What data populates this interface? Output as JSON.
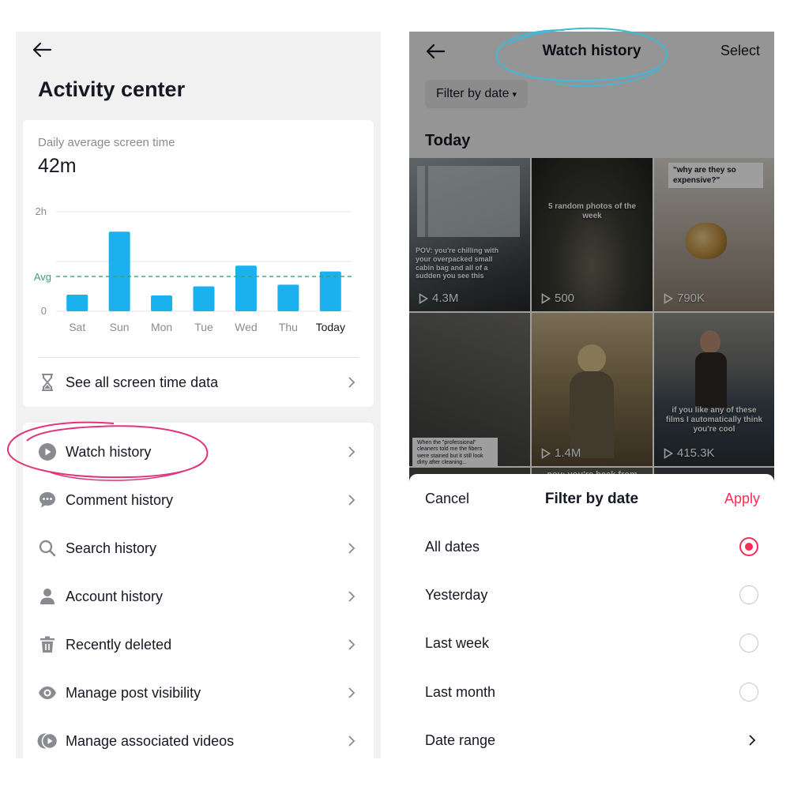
{
  "left": {
    "page_title": "Activity center",
    "chart_card": {
      "caption": "Daily average screen time",
      "value": "42m",
      "see_all_label": "See all screen time data"
    },
    "menu": [
      {
        "label": "Watch history",
        "icon": "play-circle-icon"
      },
      {
        "label": "Comment history",
        "icon": "comment-bubble-icon"
      },
      {
        "label": "Search history",
        "icon": "search-icon"
      },
      {
        "label": "Account history",
        "icon": "person-icon"
      },
      {
        "label": "Recently deleted",
        "icon": "trash-icon"
      },
      {
        "label": "Manage post visibility",
        "icon": "eye-icon"
      },
      {
        "label": "Manage associated videos",
        "icon": "associated-videos-icon"
      }
    ]
  },
  "chart_data": {
    "type": "bar",
    "categories": [
      "Sat",
      "Sun",
      "Mon",
      "Tue",
      "Wed",
      "Thu",
      "Today"
    ],
    "values": [
      20,
      96,
      19,
      30,
      55,
      32,
      48
    ],
    "y_unit": "minutes",
    "ytick_labels": [
      "0",
      "2h"
    ],
    "ylim": [
      0,
      120
    ],
    "avg_label": "Avg",
    "avg_value": 42,
    "bar_color": "#1bb0ee",
    "avg_color": "#3d9b7f",
    "grid": true
  },
  "right": {
    "title": "Watch history",
    "select_label": "Select",
    "filter_chip_label": "Filter by date",
    "section_label": "Today",
    "thumbnails": [
      {
        "views": "4.3M",
        "overlay": "POV: you're chilling with your overpacked small cabin bag and all of a sudden you see this"
      },
      {
        "views": "500",
        "overlay": "5 random photos of the week"
      },
      {
        "views": "790K",
        "overlay": "\"why are they so expensive?\""
      },
      {
        "views": "",
        "overlay": "When the \"professional\" cleaners told me the fibers were stained but it still look dirty after cleaning..."
      },
      {
        "views": "1.4M",
        "overlay": ""
      },
      {
        "views": "415.3K",
        "overlay": "if you like any of these films I automatically think you're cool"
      }
    ],
    "peek_caption": "pov: you're back from",
    "sheet": {
      "cancel_label": "Cancel",
      "title": "Filter by date",
      "apply_label": "Apply",
      "options": [
        {
          "label": "All dates",
          "selected": true
        },
        {
          "label": "Yesterday",
          "selected": false
        },
        {
          "label": "Last week",
          "selected": false
        },
        {
          "label": "Last month",
          "selected": false
        }
      ],
      "date_range_label": "Date range"
    }
  },
  "colors": {
    "accent": "#fe2c55",
    "annotation_pink": "#e0357a",
    "annotation_blue": "#3fb9d8"
  }
}
